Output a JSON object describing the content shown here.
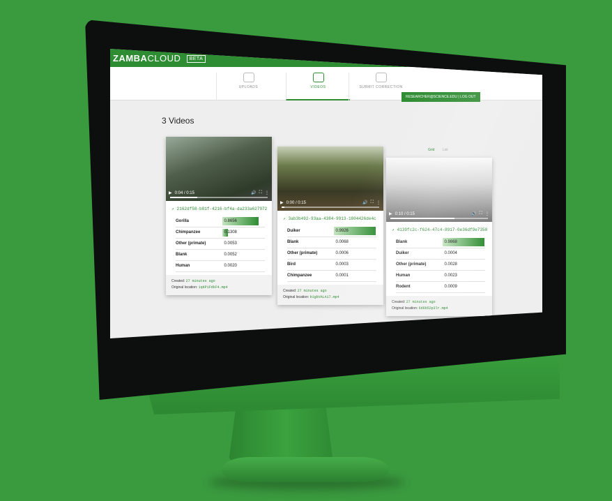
{
  "brand": {
    "name_bold": "ZAMBA",
    "name_light": "CLOUD",
    "badge": "BETA"
  },
  "nav": {
    "tabs": [
      {
        "label": "UPLOADS",
        "icon": "upload-cloud-icon"
      },
      {
        "label": "VIDEOS",
        "icon": "play-icon"
      },
      {
        "label": "SUBMIT CORRECTION",
        "icon": "edit-icon"
      }
    ],
    "user": "RESEARCHER@SCIENCE.EDU",
    "logout": "LOG OUT"
  },
  "page": {
    "title": "3 Videos"
  },
  "view": {
    "grid": "Grid",
    "list": "List"
  },
  "videos": [
    {
      "time": "0:04 / 0:15",
      "id": "2162df58-b81f-4216-bf4a-da233a627972",
      "scores": [
        {
          "label": "Gorilla",
          "value": "0.8656",
          "fill": 0.8656
        },
        {
          "label": "Chimpanzee",
          "value": "0.1308",
          "fill": 0.1308
        },
        {
          "label": "Other (primate)",
          "value": "0.0053",
          "fill": 0
        },
        {
          "label": "Blank",
          "value": "0.0052",
          "fill": 0
        },
        {
          "label": "Human",
          "value": "0.0020",
          "fill": 0
        }
      ],
      "created_label": "Created:",
      "created": "27 minutes ago",
      "location_label": "Original location:",
      "location": "1qKP1FdkF4.mp4"
    },
    {
      "time": "0:00 / 0:15",
      "id": "3ab3b492-93aa-4384-9913-1804426de4c",
      "scores": [
        {
          "label": "Duiker",
          "value": "0.9926",
          "fill": 0.9926
        },
        {
          "label": "Blank",
          "value": "0.0068",
          "fill": 0
        },
        {
          "label": "Other (primate)",
          "value": "0.0006",
          "fill": 0
        },
        {
          "label": "Bird",
          "value": "0.0003",
          "fill": 0
        },
        {
          "label": "Chimpanzee",
          "value": "0.0001",
          "fill": 0
        }
      ],
      "created_label": "Created:",
      "created": "27 minutes ago",
      "location_label": "Original location:",
      "location": "b1gbVALA17.mp4"
    },
    {
      "time": "0:10 / 0:15",
      "id": "4139fc2c-f624-47c4-8917-0e36df9e7350",
      "scores": [
        {
          "label": "Blank",
          "value": "0.9868",
          "fill": 0.9868
        },
        {
          "label": "Duiker",
          "value": "0.0004",
          "fill": 0
        },
        {
          "label": "Other (primate)",
          "value": "0.0028",
          "fill": 0
        },
        {
          "label": "Human",
          "value": "0.0023",
          "fill": 0
        },
        {
          "label": "Rodent",
          "value": "0.0009",
          "fill": 0
        }
      ],
      "created_label": "Created:",
      "created": "27 minutes ago",
      "location_label": "Original location:",
      "location": "6d6b52p3lr.mp4"
    }
  ],
  "colors": {
    "brand_green": "#2e8c32",
    "background": "#3a9a3e"
  }
}
